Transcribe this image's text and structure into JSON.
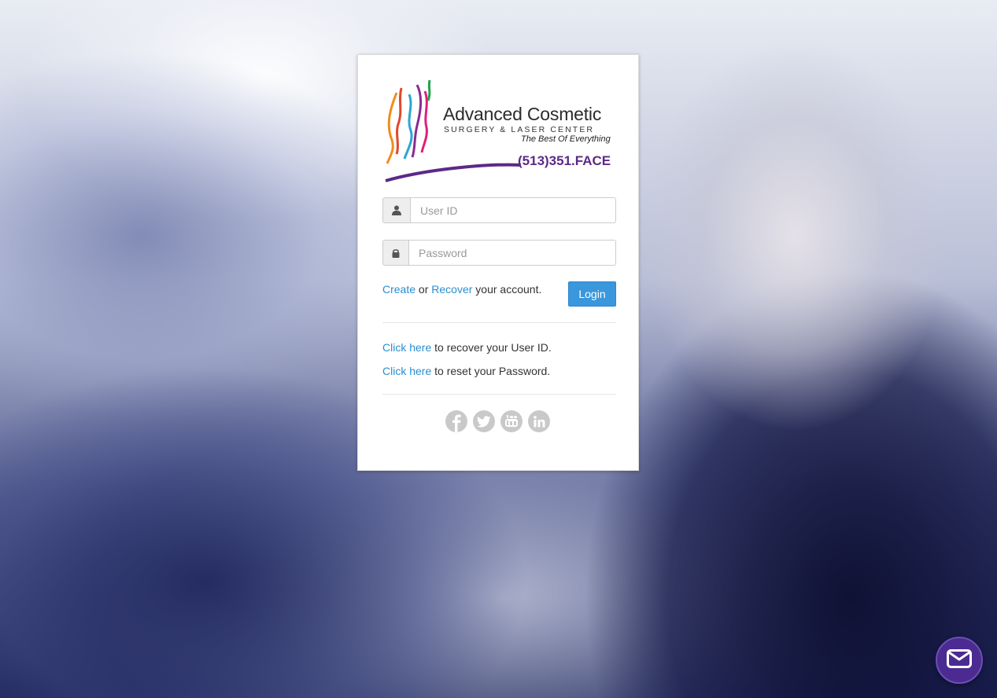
{
  "logo": {
    "title": "Advanced Cosmetic",
    "subtitle": "SURGERY & LASER CENTER",
    "tagline": "The Best Of Everything",
    "phone": "(513)351.FACE"
  },
  "form": {
    "user_id_placeholder": "User ID",
    "password_placeholder": "Password",
    "create_link": "Create",
    "or_text": " or ",
    "recover_link": "Recover",
    "account_suffix": " your account.",
    "login_label": "Login"
  },
  "recovery": {
    "user_id_link": "Click here",
    "user_id_text": " to recover your User ID.",
    "password_link": "Click here",
    "password_text": " to reset your Password."
  },
  "social": [
    "facebook-icon",
    "twitter-icon",
    "youtube-icon",
    "linkedin-icon"
  ],
  "colors": {
    "link": "#2a8fd0",
    "login_button": "#3a97dc",
    "brand_purple": "#5b2a86",
    "mail_button": "#4b2b91"
  }
}
